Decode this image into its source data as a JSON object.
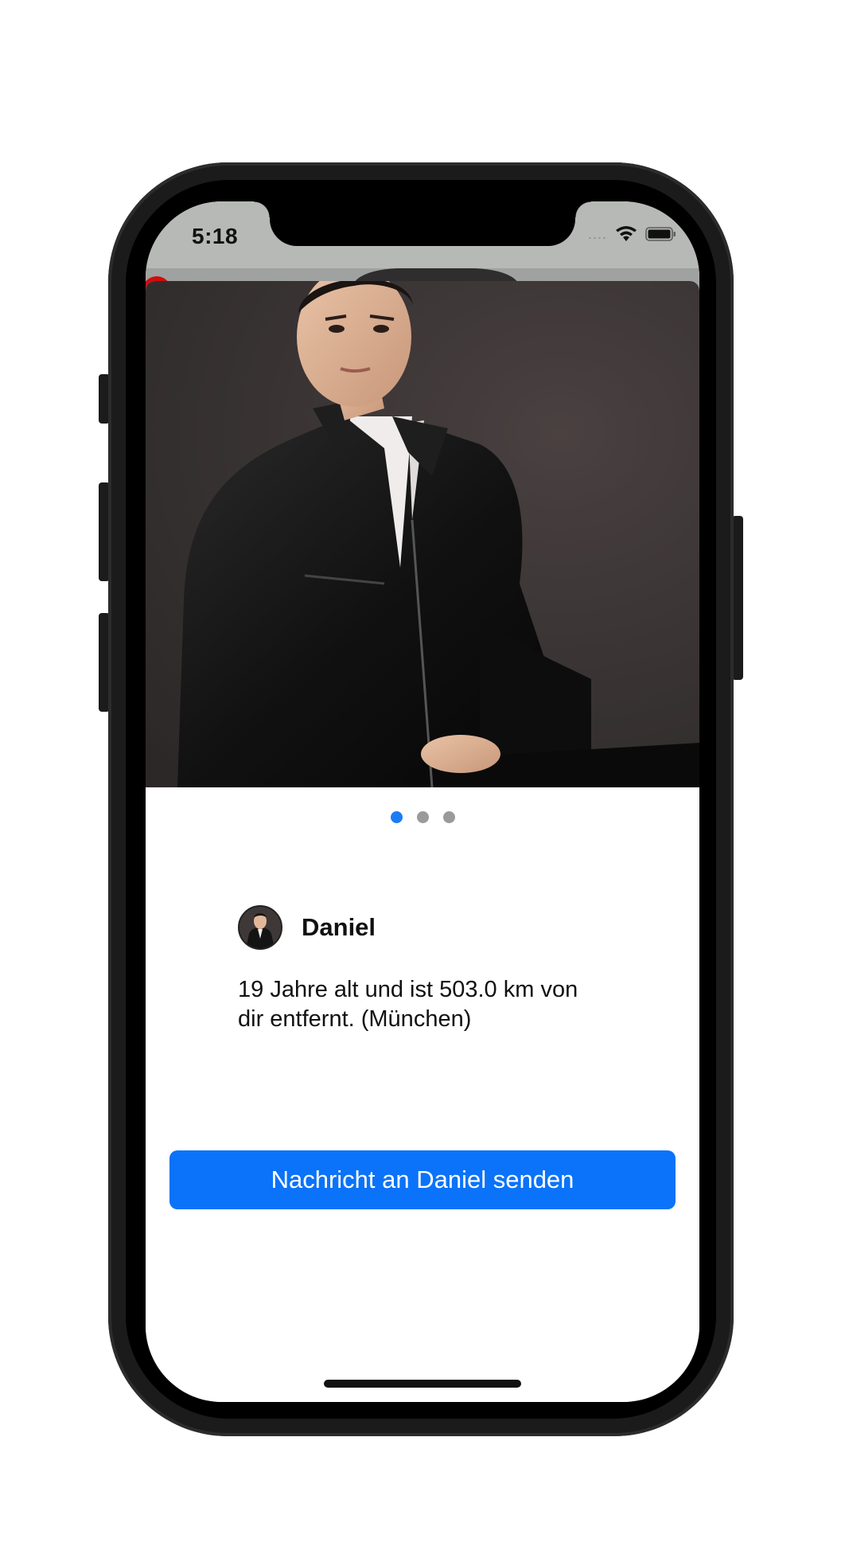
{
  "status_bar": {
    "time": "5:18",
    "signal": "....",
    "icons": [
      "wifi-icon",
      "battery-icon"
    ]
  },
  "carousel": {
    "page_count": 3,
    "current_page": 1
  },
  "profile": {
    "name": "Daniel",
    "bio": "19 Jahre alt und ist 503.0 km von dir entfernt. (München)"
  },
  "actions": {
    "send_message_label": "Nachricht an Daniel senden"
  },
  "colors": {
    "accent": "#0a73f9",
    "dot_active": "#1a7cf5",
    "dot_inactive": "#9a9a9a"
  }
}
